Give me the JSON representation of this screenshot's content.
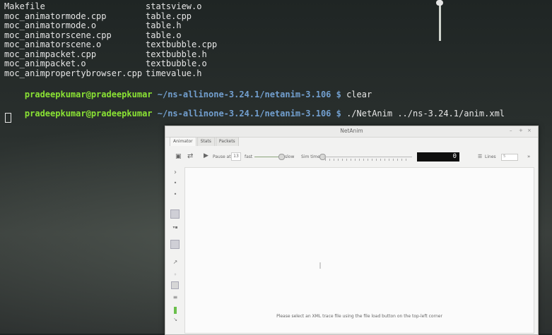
{
  "terminal": {
    "files": [
      [
        "Makefile",
        "statsview.o"
      ],
      [
        "moc_animatormode.cpp",
        "table.cpp"
      ],
      [
        "moc_animatormode.o",
        "table.h"
      ],
      [
        "moc_animatorscene.cpp",
        "table.o"
      ],
      [
        "moc_animatorscene.o",
        "textbubble.cpp"
      ],
      [
        "moc_animpacket.cpp",
        "textbubble.h"
      ],
      [
        "moc_animpacket.o",
        "textbubble.o"
      ],
      [
        "moc_animpropertybrowser.cpp",
        "timevalue.h"
      ]
    ],
    "prompt1": {
      "user": "pradeepkumar@pradeepkumar",
      "path": " ~/ns-allinone-3.24.1/netanim-3.106 $",
      "cmd": " clear"
    },
    "prompt2": {
      "user": "pradeepkumar@pradeepkumar",
      "path": " ~/ns-allinone-3.24.1/netanim-3.106 $",
      "cmd": " ./NetAnim ../ns-3.24.1/anim.xml"
    }
  },
  "netanim": {
    "title": "NetAnim",
    "window_controls": {
      "minimize": "–",
      "maximize": "+",
      "close": "×"
    },
    "tabs": [
      "Animator",
      "Stats",
      "Packets"
    ],
    "toolbar": {
      "pause_label": "Pause at",
      "pause_value": "13",
      "fast_label": "fast",
      "slow_label": "slow",
      "simtime_label": "Sim time",
      "lcd_value": "0",
      "lines_label": "Lines",
      "lines_value": "5",
      "more": "»"
    },
    "canvas_message": "Please select an XML trace file using the file load button on the top-left corner"
  }
}
